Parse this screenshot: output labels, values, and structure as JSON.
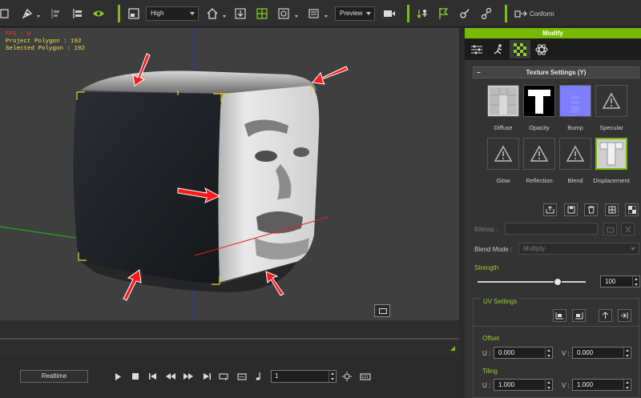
{
  "toolbar": {
    "quality": "High",
    "render_mode": "Preview",
    "conform_label": "Conform"
  },
  "viewport": {
    "fps": "FPS : 0",
    "project_polygon": "Project Polygon : 192",
    "selected_polygon": "Selected Polygon : 192"
  },
  "playback": {
    "realtime_label": "Realtime",
    "frame": "1"
  },
  "panel": {
    "title": "Modify",
    "section_title": "Texture Settings  (Y)",
    "textures": [
      {
        "label": "Diffuse"
      },
      {
        "label": "Opacity"
      },
      {
        "label": "Bump"
      },
      {
        "label": "Specular"
      },
      {
        "label": "Glow"
      },
      {
        "label": "Reflection"
      },
      {
        "label": "Blend"
      },
      {
        "label": "Displacement"
      }
    ],
    "bitmap_label": "Bitmap :",
    "blend_mode_label": "Blend Mode :",
    "blend_mode_value": "Multiply",
    "strength_label": "Strength",
    "strength_value": "100",
    "strength_level": 0.74,
    "uv_settings_label": "UV Settings",
    "offset_label": "Offset",
    "tiling_label": "Tiling",
    "u_label": "U :",
    "v_label": "V :",
    "offset_u": "0.000",
    "offset_v": "0.000",
    "tiling_u": "1.000",
    "tiling_v": "1.000"
  },
  "colors": {
    "accent": "#76b900",
    "arrow": "#ff1a1a"
  }
}
